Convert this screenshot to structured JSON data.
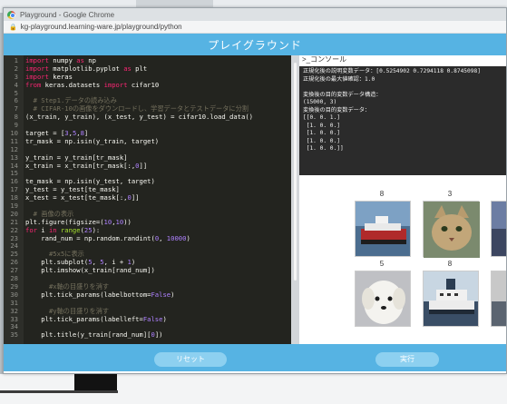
{
  "browser": {
    "window_title": "Playground - Google Chrome",
    "address": "kg-playground.learning-ware.jp/playground/python"
  },
  "app": {
    "title": "プレイグラウンド",
    "console_label": ">_コンソール",
    "reset_label": "リセット",
    "run_label": "実行"
  },
  "editor": {
    "lines": [
      {
        "n": "1",
        "segs": [
          {
            "t": "import",
            "c": "kw"
          },
          {
            "t": " numpy ",
            "c": "txt"
          },
          {
            "t": "as",
            "c": "kw"
          },
          {
            "t": " np",
            "c": "txt"
          }
        ]
      },
      {
        "n": "2",
        "segs": [
          {
            "t": "import",
            "c": "kw"
          },
          {
            "t": " matplotlib.pyplot ",
            "c": "txt"
          },
          {
            "t": "as",
            "c": "kw"
          },
          {
            "t": " plt",
            "c": "txt"
          }
        ]
      },
      {
        "n": "3",
        "segs": [
          {
            "t": "import",
            "c": "kw"
          },
          {
            "t": " keras",
            "c": "txt"
          }
        ]
      },
      {
        "n": "4",
        "segs": [
          {
            "t": "from",
            "c": "kw"
          },
          {
            "t": " keras.datasets ",
            "c": "txt"
          },
          {
            "t": "import",
            "c": "kw"
          },
          {
            "t": " cifar10",
            "c": "txt"
          }
        ]
      },
      {
        "n": "5",
        "segs": []
      },
      {
        "n": "6",
        "segs": [
          {
            "t": "  # Step1.データの読み込み",
            "c": "cm"
          }
        ]
      },
      {
        "n": "7",
        "segs": [
          {
            "t": "  # CIFAR-10の画像をダウンロードし、学習データとテストデータに分割",
            "c": "cm"
          }
        ]
      },
      {
        "n": "8",
        "segs": [
          {
            "t": "(x_train, y_train), (x_test, y_test) = cifar10.load_data()",
            "c": "txt"
          }
        ]
      },
      {
        "n": "9",
        "segs": []
      },
      {
        "n": "10",
        "segs": [
          {
            "t": "target = [",
            "c": "txt"
          },
          {
            "t": "3",
            "c": "num"
          },
          {
            "t": ",",
            "c": "txt"
          },
          {
            "t": "5",
            "c": "num"
          },
          {
            "t": ",",
            "c": "txt"
          },
          {
            "t": "8",
            "c": "num"
          },
          {
            "t": "]",
            "c": "txt"
          }
        ]
      },
      {
        "n": "11",
        "segs": [
          {
            "t": "tr_mask = np.isin(y_train, target)",
            "c": "txt"
          }
        ]
      },
      {
        "n": "12",
        "segs": []
      },
      {
        "n": "13",
        "segs": [
          {
            "t": "y_train = y_train[tr_mask]",
            "c": "txt"
          }
        ]
      },
      {
        "n": "14",
        "segs": [
          {
            "t": "x_train = x_train[tr_mask[:,",
            "c": "txt"
          },
          {
            "t": "0",
            "c": "num"
          },
          {
            "t": "]]",
            "c": "txt"
          }
        ]
      },
      {
        "n": "15",
        "segs": []
      },
      {
        "n": "16",
        "segs": [
          {
            "t": "te_mask = np.isin(y_test, target)",
            "c": "txt"
          }
        ]
      },
      {
        "n": "17",
        "segs": [
          {
            "t": "y_test = y_test[te_mask]",
            "c": "txt"
          }
        ]
      },
      {
        "n": "18",
        "segs": [
          {
            "t": "x_test = x_test[te_mask[:,",
            "c": "txt"
          },
          {
            "t": "0",
            "c": "num"
          },
          {
            "t": "]]",
            "c": "txt"
          }
        ]
      },
      {
        "n": "19",
        "segs": []
      },
      {
        "n": "20",
        "segs": [
          {
            "t": "  # 画像の表示",
            "c": "cm"
          }
        ]
      },
      {
        "n": "21",
        "segs": [
          {
            "t": "plt.figure(figsize=(",
            "c": "txt"
          },
          {
            "t": "10",
            "c": "num"
          },
          {
            "t": ",",
            "c": "txt"
          },
          {
            "t": "10",
            "c": "num"
          },
          {
            "t": "))",
            "c": "txt"
          }
        ]
      },
      {
        "n": "22",
        "segs": [
          {
            "t": "for",
            "c": "kw"
          },
          {
            "t": " i ",
            "c": "txt"
          },
          {
            "t": "in",
            "c": "kw"
          },
          {
            "t": " ",
            "c": "txt"
          },
          {
            "t": "range",
            "c": "fn"
          },
          {
            "t": "(",
            "c": "txt"
          },
          {
            "t": "25",
            "c": "num"
          },
          {
            "t": "):",
            "c": "txt"
          }
        ]
      },
      {
        "n": "23",
        "segs": [
          {
            "t": "    rand_num = np.random.randint(",
            "c": "txt"
          },
          {
            "t": "0",
            "c": "num"
          },
          {
            "t": ", ",
            "c": "txt"
          },
          {
            "t": "10000",
            "c": "num"
          },
          {
            "t": ")",
            "c": "txt"
          }
        ]
      },
      {
        "n": "24",
        "segs": []
      },
      {
        "n": "25",
        "segs": [
          {
            "t": "      #5x5に表示",
            "c": "cm"
          }
        ]
      },
      {
        "n": "26",
        "segs": [
          {
            "t": "    plt.subplot(",
            "c": "txt"
          },
          {
            "t": "5",
            "c": "num"
          },
          {
            "t": ", ",
            "c": "txt"
          },
          {
            "t": "5",
            "c": "num"
          },
          {
            "t": ", i + ",
            "c": "txt"
          },
          {
            "t": "1",
            "c": "num"
          },
          {
            "t": ")",
            "c": "txt"
          }
        ]
      },
      {
        "n": "27",
        "segs": [
          {
            "t": "    plt.imshow(x_train[rand_num])",
            "c": "txt"
          }
        ]
      },
      {
        "n": "28",
        "segs": []
      },
      {
        "n": "29",
        "segs": [
          {
            "t": "      #x軸の目盛りを消す",
            "c": "cm"
          }
        ]
      },
      {
        "n": "30",
        "segs": [
          {
            "t": "    plt.tick_params(labelbottom=",
            "c": "txt"
          },
          {
            "t": "False",
            "c": "num"
          },
          {
            "t": ")",
            "c": "txt"
          }
        ]
      },
      {
        "n": "31",
        "segs": []
      },
      {
        "n": "32",
        "segs": [
          {
            "t": "      #y軸の目盛りを消す",
            "c": "cm"
          }
        ]
      },
      {
        "n": "33",
        "segs": [
          {
            "t": "    plt.tick_params(labelleft=",
            "c": "txt"
          },
          {
            "t": "False",
            "c": "num"
          },
          {
            "t": ")",
            "c": "txt"
          }
        ]
      },
      {
        "n": "34",
        "segs": []
      },
      {
        "n": "35",
        "segs": [
          {
            "t": "    plt.title(y_train[rand_num][",
            "c": "txt"
          },
          {
            "t": "0",
            "c": "num"
          },
          {
            "t": "])",
            "c": "txt"
          }
        ]
      }
    ]
  },
  "console": {
    "text": "正規化後の説明変数データ：[0.5254902 0.7294118 0.8745098]\n正規化後の最大値確認：1.0\n\n変換後の目的変数データ構造：\n(15000, 3)\n変換後の目的変数データ：\n[[0. 0. 1.]\n [1. 0. 0.]\n [1. 0. 0.]\n [1. 0. 0.]\n [1. 0. 0.]]"
  },
  "images": {
    "labels": [
      "8",
      "3",
      "5",
      "8"
    ]
  },
  "colors": {
    "header": "#56b3e3",
    "button": "#8dd0f0",
    "editor_bg": "#23241f"
  }
}
